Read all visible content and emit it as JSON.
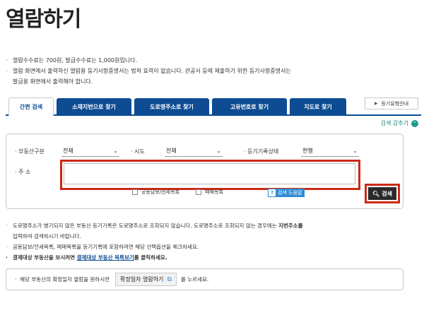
{
  "page": {
    "title": "열람하기"
  },
  "notes_top": [
    "열람수수료는 700원, 발급수수료는 1,000원입니다.",
    "열람 화면에서 출력하신 열람용 등기사항증명서는 법적 효력이 없습니다. 관공서 등에 제출하기 위한 등기사항증명서는",
    "발급용 화면에서 출력해야 합니다."
  ],
  "tabs": [
    {
      "label": "간편 검색"
    },
    {
      "label": "소재지번으로 찾기"
    },
    {
      "label": "도로명주소로 찾기"
    },
    {
      "label": "고유번호로 찾기"
    },
    {
      "label": "지도로 찾기"
    }
  ],
  "guide_button": {
    "label": "등기유형안내"
  },
  "search_hide": {
    "label": "검색 감추기"
  },
  "form": {
    "property_type": {
      "label": "부동산구분",
      "value": "전체"
    },
    "sido": {
      "label": "시도",
      "value": "전체"
    },
    "record_status": {
      "label": "등기기록상태",
      "value": "현행"
    },
    "address": {
      "label": "주 소",
      "value": ""
    },
    "collateral_checkbox": {
      "label": "공동담보/전세목록"
    },
    "sale_checkbox": {
      "label": "매매목록"
    },
    "help": {
      "label": "검색 도움말"
    },
    "search_button": {
      "label": "검색"
    }
  },
  "notes_bottom": {
    "n1a": "도로명주소가 병기되지 않은 부동산 등기기록은 도로명주소로 조회되지 않습니다. 도로명주소로 조회되지 않는 경우에는 ",
    "n1b": "지번주소를",
    "n1c": "입력하여 검색하시기 바랍니다.",
    "n2": "공동담보/전세목록, 매매목록을 등기기록에 포함하려면 해당 선택옵션을 체크하세요.",
    "n3a": "결제대상 부동산을 보시려면 ",
    "n3link": "결제대상 부동산 목록보기",
    "n3b": "를 클릭하세요."
  },
  "info_box": {
    "text_before": "해당 부동산의 확정일자 열람을 원하시면",
    "button": "확정일자 열람하기",
    "text_after": "를 누르세요."
  }
}
